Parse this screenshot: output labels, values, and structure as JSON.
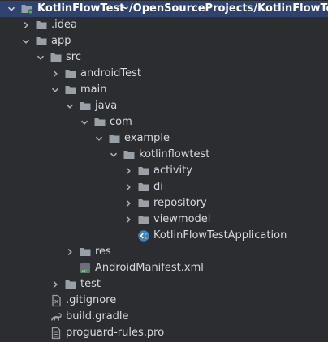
{
  "project": {
    "name": "KotlinFlowTest",
    "path": "~/OpenSourceProjects/KotlinFlowTest"
  },
  "tree": [
    {
      "label": ".idea",
      "level": 1,
      "expanded": false,
      "icon": "folder-icon"
    },
    {
      "label": "app",
      "level": 1,
      "expanded": true,
      "icon": "folder-icon"
    },
    {
      "label": "src",
      "level": 2,
      "expanded": true,
      "icon": "folder-icon"
    },
    {
      "label": "androidTest",
      "level": 3,
      "expanded": false,
      "icon": "folder-icon"
    },
    {
      "label": "main",
      "level": 3,
      "expanded": true,
      "icon": "folder-icon"
    },
    {
      "label": "java",
      "level": 4,
      "expanded": true,
      "icon": "folder-icon"
    },
    {
      "label": "com",
      "level": 5,
      "expanded": true,
      "icon": "folder-icon"
    },
    {
      "label": "example",
      "level": 6,
      "expanded": true,
      "icon": "folder-icon"
    },
    {
      "label": "kotlinflowtest",
      "level": 7,
      "expanded": true,
      "icon": "folder-icon"
    },
    {
      "label": "activity",
      "level": 8,
      "expanded": false,
      "icon": "folder-icon"
    },
    {
      "label": "di",
      "level": 8,
      "expanded": false,
      "icon": "folder-icon"
    },
    {
      "label": "repository",
      "level": 8,
      "expanded": false,
      "icon": "folder-icon"
    },
    {
      "label": "viewmodel",
      "level": 8,
      "expanded": false,
      "icon": "folder-icon"
    },
    {
      "label": "KotlinFlowTestApplication",
      "level": 8,
      "expanded": null,
      "icon": "kotlin-class-icon"
    },
    {
      "label": "res",
      "level": 4,
      "expanded": false,
      "icon": "folder-icon"
    },
    {
      "label": "AndroidManifest.xml",
      "level": 4,
      "expanded": null,
      "icon": "manifest-file-icon"
    },
    {
      "label": "test",
      "level": 3,
      "expanded": false,
      "icon": "folder-icon"
    },
    {
      "label": ".gitignore",
      "level": 2,
      "expanded": null,
      "icon": "gitignore-file-icon"
    },
    {
      "label": "build.gradle",
      "level": 2,
      "expanded": null,
      "icon": "gradle-file-icon"
    },
    {
      "label": "proguard-rules.pro",
      "level": 2,
      "expanded": null,
      "icon": "text-file-icon"
    }
  ],
  "colors": {
    "background": "#2b2d30",
    "selection": "#2e436e",
    "folder": "#9aa0a8",
    "kotlin": "#7f52ff",
    "text": "#d6d9de"
  }
}
